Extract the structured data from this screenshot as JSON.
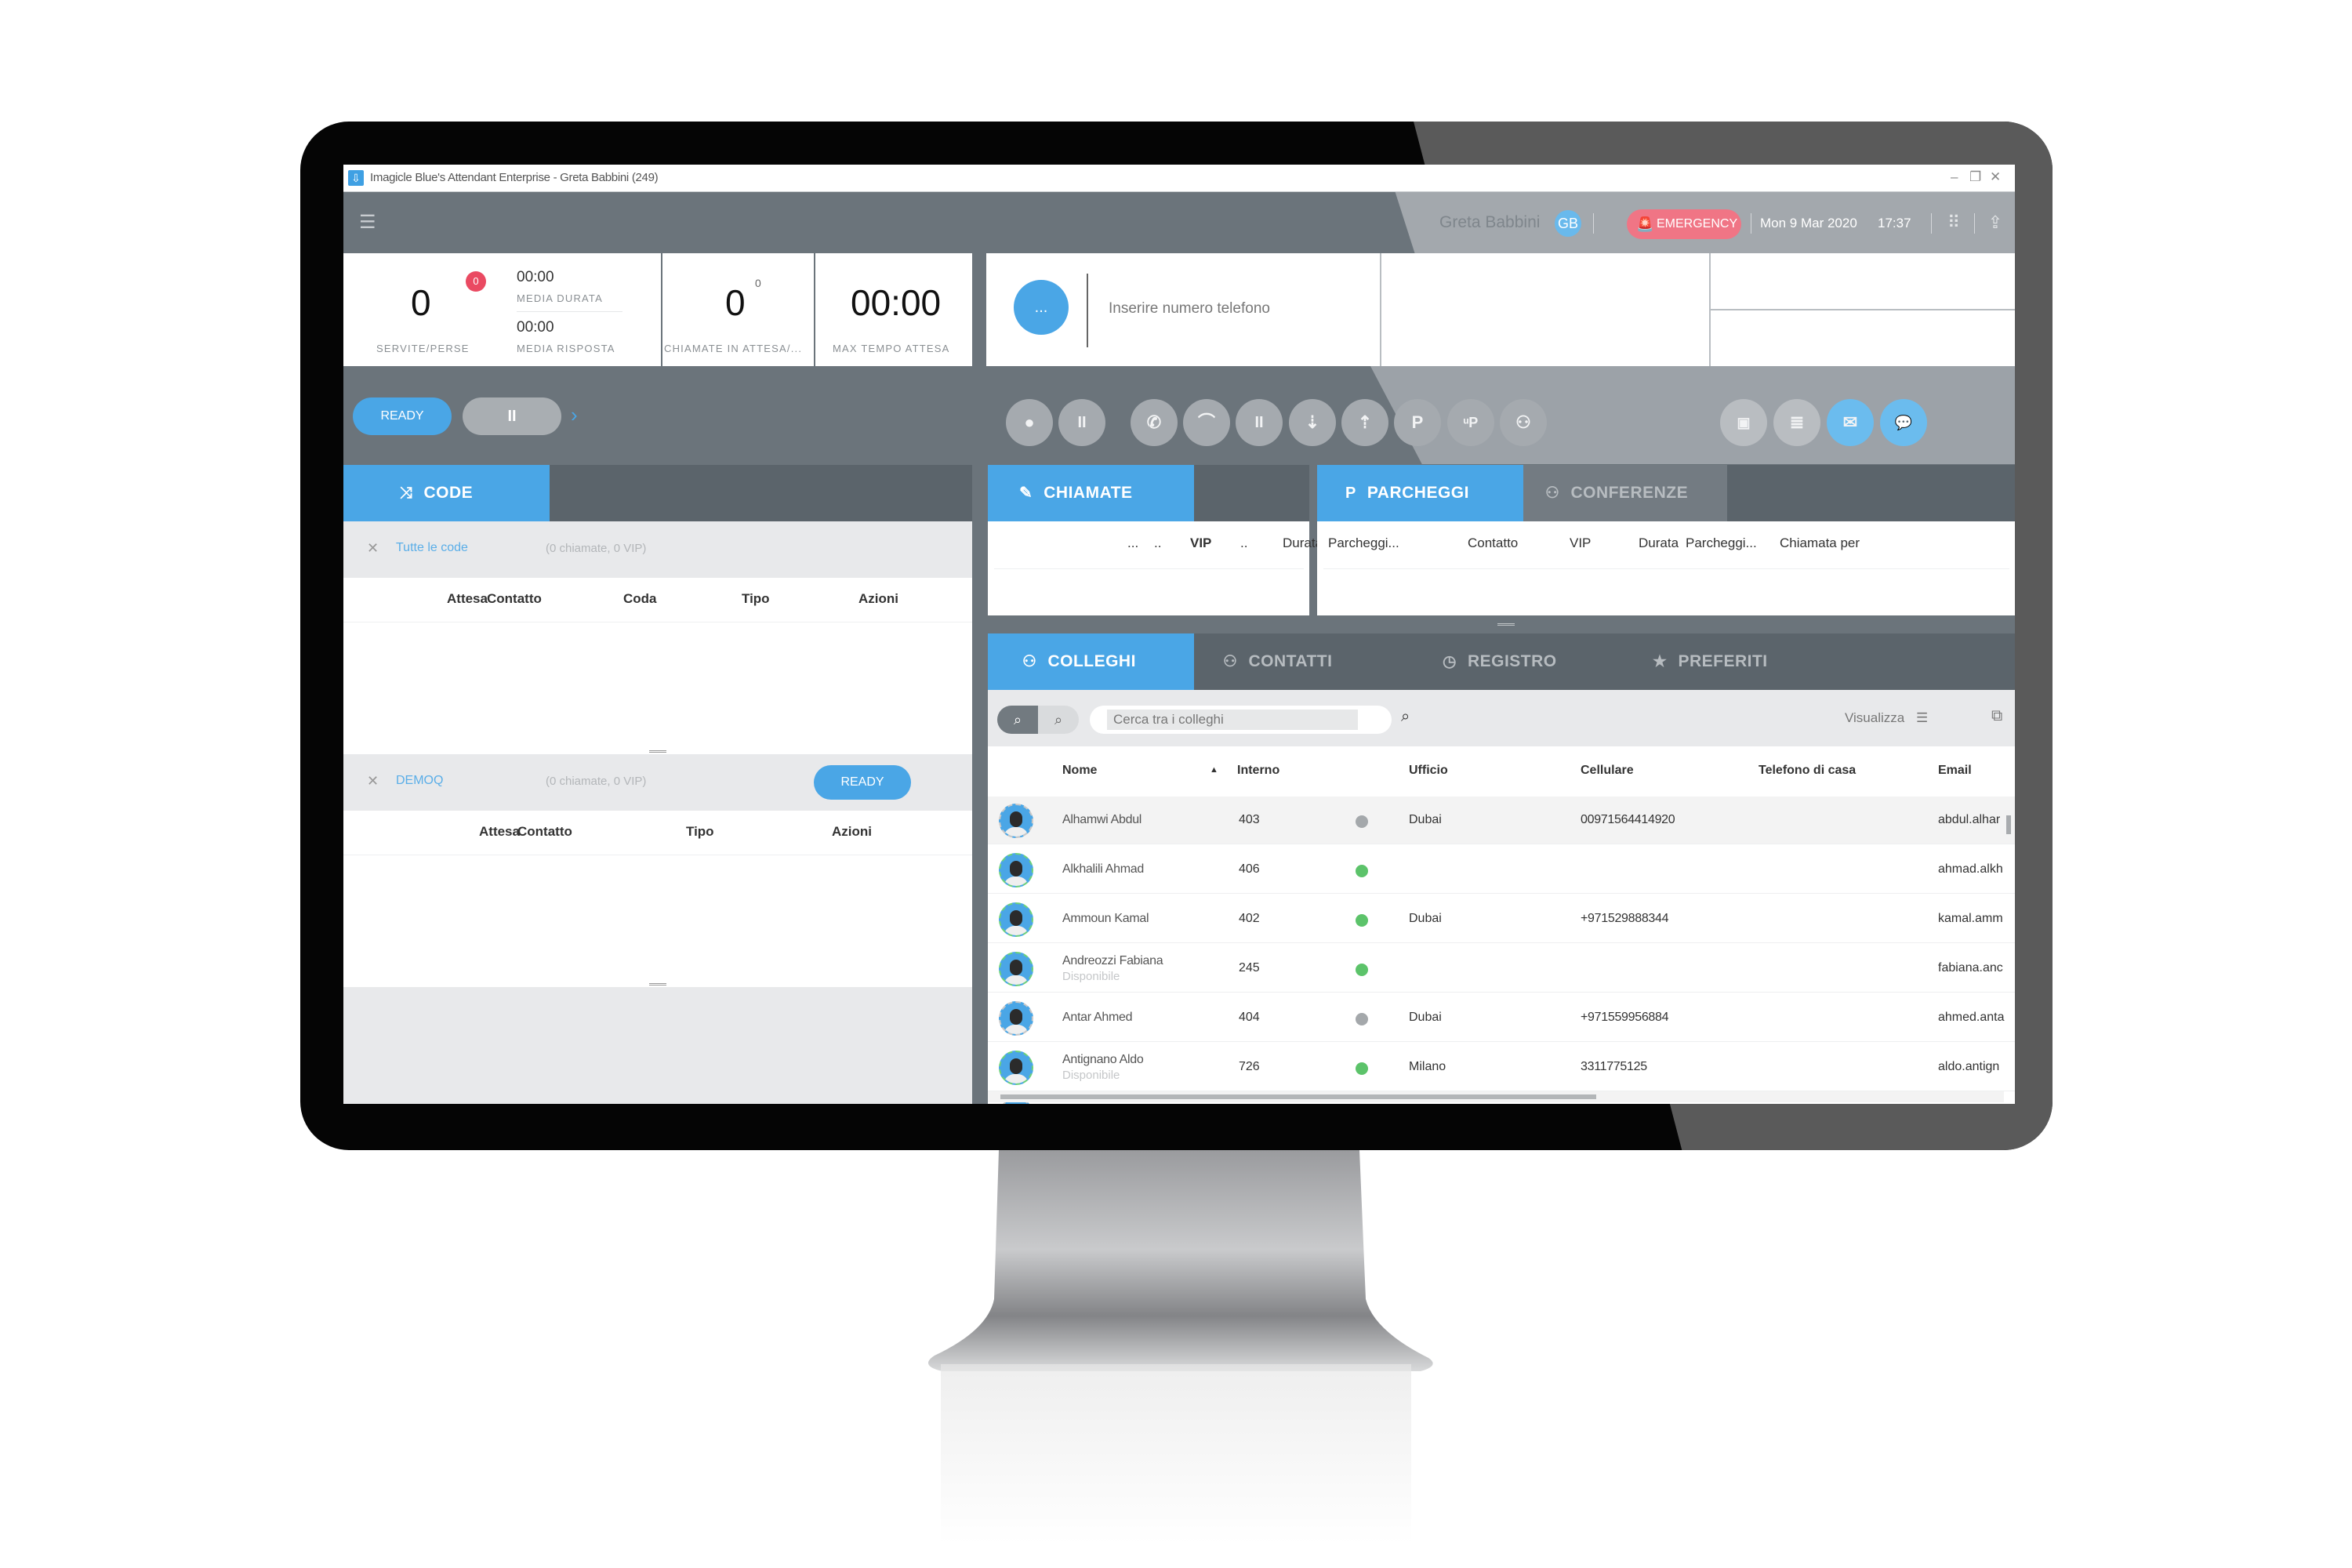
{
  "window": {
    "title": "Imagicle Blue's Attendant Enterprise - Greta Babbini (249)",
    "minimize": "–",
    "restore": "❐",
    "close": "✕"
  },
  "header": {
    "menu_icon": "☰",
    "user_name": "Greta Babbini",
    "user_initials": "GB",
    "emergency_label": "EMERGENCY",
    "emergency_icon": "🚨",
    "date": "Mon 9 Mar 2020",
    "time": "17:37",
    "dialpad_icon": "⠿",
    "dock_icon": "⇪"
  },
  "stats": {
    "served": "0",
    "missed_badge": "0",
    "served_label": "SERVITE/PERSE",
    "avg_duration": "00:00",
    "avg_duration_label": "MEDIA DURATA",
    "avg_answer": "00:00",
    "avg_answer_label": "MEDIA RISPOSTA",
    "waiting": "0",
    "waiting_sup": "0",
    "waiting_label": "CHIAMATE IN ATTESA/...",
    "max_wait": "00:00",
    "max_wait_label": "MAX TEMPO ATTESA"
  },
  "dial": {
    "more_button": "...",
    "placeholder": "Inserire numero telefono"
  },
  "toolbar": {
    "ready_label": "READY",
    "pause_label": "II",
    "expand_icon": "›",
    "buttons": [
      {
        "name": "record",
        "glyph": "●"
      },
      {
        "name": "pause-record",
        "glyph": "II"
      },
      {
        "name": "answer",
        "glyph": "✆"
      },
      {
        "name": "hangup",
        "glyph": "⌒"
      },
      {
        "name": "hold",
        "glyph": "II"
      },
      {
        "name": "transfer",
        "glyph": "⇣"
      },
      {
        "name": "consult-transfer",
        "glyph": "⇡"
      },
      {
        "name": "park",
        "glyph": "P"
      },
      {
        "name": "park-to-user",
        "glyph": "ᵘP"
      },
      {
        "name": "conference",
        "glyph": "⚇"
      }
    ],
    "right_buttons": [
      {
        "name": "contact-card",
        "glyph": "▣"
      },
      {
        "name": "notes",
        "glyph": "≣"
      },
      {
        "name": "email",
        "glyph": "✉"
      },
      {
        "name": "chat",
        "glyph": "💬"
      }
    ]
  },
  "queues": {
    "tab_label": "CODE",
    "tab_icon": "⤨",
    "groups": [
      {
        "name": "Tutte le code",
        "count": "(0 chiamate, 0 VIP)",
        "columns": [
          "Attesa",
          "Contatto",
          "Coda",
          "Tipo",
          "Azioni"
        ]
      },
      {
        "name": "DEMOQ",
        "count": "(0 chiamate, 0 VIP)",
        "ready_label": "READY",
        "columns": [
          "Attesa",
          "Contatto",
          "Tipo",
          "Azioni"
        ]
      }
    ],
    "close_icon": "✕"
  },
  "calls": {
    "tab_label": "CHIAMATE",
    "tab_icon": "✎",
    "columns": [
      "...",
      "..",
      "VIP",
      "..",
      "Durata",
      ".."
    ]
  },
  "parking": {
    "tabs": [
      {
        "label": "PARCHEGGI",
        "icon": "P",
        "active": true
      },
      {
        "label": "CONFERENZE",
        "icon": "⚇",
        "active": false
      }
    ],
    "columns": [
      "Parcheggi...",
      "Contatto",
      "VIP",
      "Durata",
      "Parcheggi...",
      "Chiamata per"
    ]
  },
  "directory": {
    "tabs": [
      {
        "label": "COLLEGHI",
        "icon": "⚇",
        "active": true
      },
      {
        "label": "CONTATTI",
        "icon": "⚇",
        "active": false
      },
      {
        "label": "REGISTRO",
        "icon": "◷",
        "active": false
      },
      {
        "label": "PREFERITI",
        "icon": "★",
        "active": false
      }
    ],
    "search_placeholder": "Cerca tra i colleghi",
    "search_icon": "⌕",
    "view_label": "Visualizza",
    "view_icon": "☰",
    "popout_icon": "⧉",
    "columns": [
      "Nome",
      "Interno",
      "Ufficio",
      "Cellulare",
      "Telefono di casa",
      "Email"
    ],
    "sort_indicator": "▲",
    "rows": [
      {
        "name": "Alhamwi Abdul",
        "status_text": "",
        "ext": "403",
        "presence": "offline",
        "office": "Dubai",
        "mobile": "00971564414920",
        "home": "",
        "email": "abdul.alhar",
        "selected": true
      },
      {
        "name": "Alkhalili Ahmad",
        "status_text": "",
        "ext": "406",
        "presence": "available",
        "office": "",
        "mobile": "",
        "home": "",
        "email": "ahmad.alkh",
        "selected": false
      },
      {
        "name": "Ammoun Kamal",
        "status_text": "",
        "ext": "402",
        "presence": "available",
        "office": "Dubai",
        "mobile": "+971529888344",
        "home": "",
        "email": "kamal.amm",
        "selected": false
      },
      {
        "name": "Andreozzi Fabiana",
        "status_text": "Disponibile",
        "ext": "245",
        "presence": "available",
        "office": "",
        "mobile": "",
        "home": "",
        "email": "fabiana.anc",
        "selected": false
      },
      {
        "name": "Antar Ahmed",
        "status_text": "",
        "ext": "404",
        "presence": "offline",
        "office": "Dubai",
        "mobile": "+971559956884",
        "home": "",
        "email": "ahmed.anta",
        "selected": false
      },
      {
        "name": "Antignano Aldo",
        "status_text": "Disponibile",
        "ext": "726",
        "presence": "available",
        "office": "Milano",
        "mobile": "3311775125",
        "home": "",
        "email": "aldo.antign",
        "selected": false
      }
    ]
  },
  "colors": {
    "accent": "#4aa6e6",
    "header": "#6b747b",
    "tabbar": "#5b646b",
    "emergency": "#f07585",
    "available": "#5cc36a",
    "offline": "#a4a8ab",
    "badge": "#ea4a62"
  }
}
